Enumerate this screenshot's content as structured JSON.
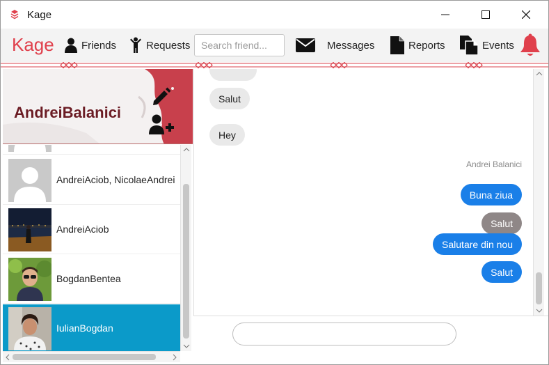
{
  "window": {
    "title": "Kage"
  },
  "nav": {
    "logo": "Kage",
    "friends_label": "Friends",
    "requests_label": "Requests",
    "search_placeholder": "Search friend...",
    "messages_label": "Messages",
    "reports_label": "Reports",
    "events_label": "Events"
  },
  "profile": {
    "username": "AndreiBalanici"
  },
  "friends": [
    {
      "name": "AndreiAciob, NicolaeAndrei",
      "avatar": "default-avatar-icon"
    },
    {
      "name": "AndreiAciob",
      "avatar": "night-lake-photo"
    },
    {
      "name": "BogdanBentea",
      "avatar": "sunglasses-photo"
    },
    {
      "name": "IulianBogdan",
      "avatar": "portrait-photo",
      "selected": true
    }
  ],
  "chat": {
    "messages": [
      {
        "text": "Salut",
        "direction": "in"
      },
      {
        "text": "Hey",
        "direction": "in"
      },
      {
        "sender": "Andrei Balanici"
      },
      {
        "text": "Buna ziua",
        "direction": "out"
      },
      {
        "text": "Salut",
        "direction": "out-grey"
      },
      {
        "text": "Salutare din nou",
        "direction": "out"
      },
      {
        "text": "Salut",
        "direction": "out"
      }
    ],
    "input_value": ""
  },
  "colors": {
    "accent": "#e0404c",
    "selected_row": "#0b9ac9",
    "outgoing_bubble": "#1a7fe8"
  }
}
